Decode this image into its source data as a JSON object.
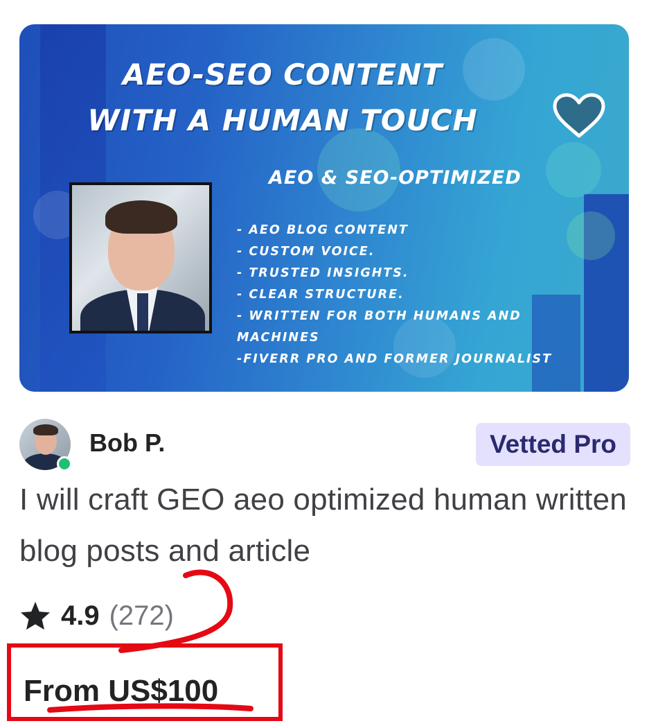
{
  "thumbnail": {
    "title_line1": "AEO-SEO CONTENT",
    "title_line2": "WITH A HUMAN TOUCH",
    "subtitle": "AEO & SEO-OPTIMIZED",
    "bullets": [
      "- AEO BLOG CONTENT",
      "- CUSTOM VOICE.",
      "- TRUSTED INSIGHTS.",
      "- CLEAR STRUCTURE.",
      "- WRITTEN FOR BOTH HUMANS AND MACHINES",
      "-FIVERR PRO AND FORMER JOURNALIST"
    ],
    "favorite_icon": "heart-icon"
  },
  "seller": {
    "name": "Bob P.",
    "online": true,
    "badge": "Vetted Pro"
  },
  "gig": {
    "title": "I will craft GEO aeo optimized human written blog posts and article"
  },
  "rating": {
    "icon": "star-icon",
    "value": "4.9",
    "count": "(272)"
  },
  "price": {
    "label": "From US$100"
  },
  "colors": {
    "badge_bg": "#e4e1ff",
    "badge_text": "#2b2a6e",
    "online": "#1dbf73",
    "annotation": "#e50914"
  }
}
